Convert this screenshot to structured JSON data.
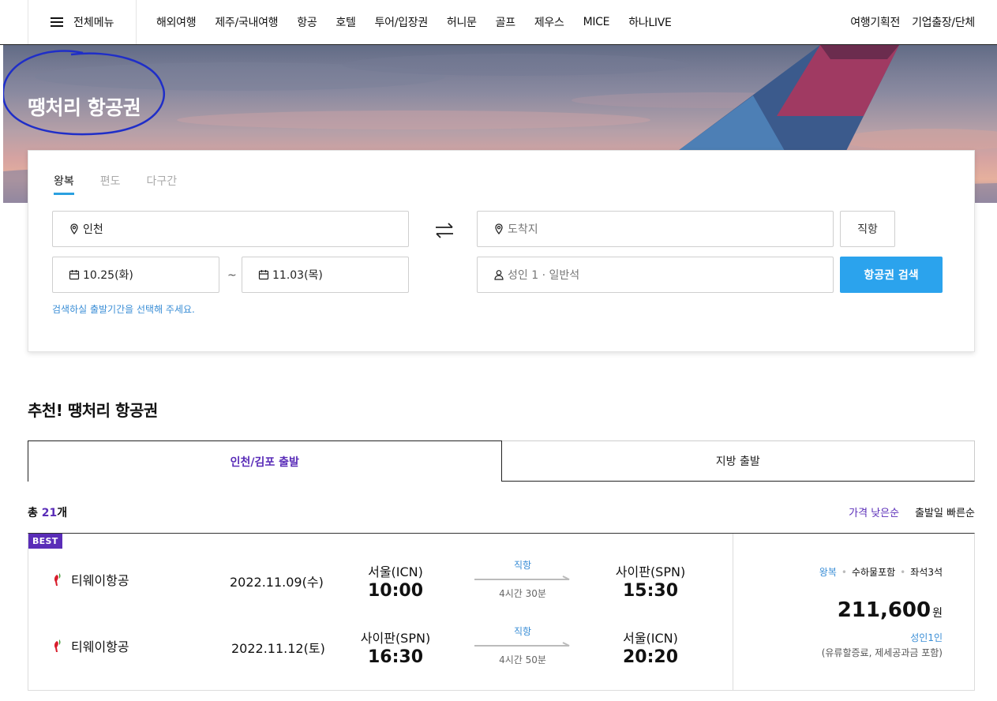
{
  "header": {
    "menu_label": "전체메뉴",
    "nav": [
      "해외여행",
      "제주/국내여행",
      "항공",
      "호텔",
      "투어/입장권",
      "허니문",
      "골프",
      "제우스",
      "MICE",
      "하나LIVE"
    ],
    "right_links": [
      "여행기획전",
      "기업출장/단체"
    ]
  },
  "hero": {
    "title": "땡처리 항공권"
  },
  "search": {
    "tabs": [
      "왕복",
      "편도",
      "다구간"
    ],
    "active_tab": "왕복",
    "origin": "인천",
    "destination_placeholder": "도착지",
    "depart_date": "10.25(화)",
    "return_date": "11.03(목)",
    "date_separator": "~",
    "passengers": "성인 1 · 일반석",
    "direct_label": "직항",
    "search_button": "항공권 검색",
    "hint": "검색하실 출발기간을 선택해 주세요."
  },
  "recommend": {
    "title": "추천! 땡처리 항공권",
    "tabs": [
      "인천/김포 출발",
      "지방 출발"
    ],
    "total_prefix": "총 ",
    "total_count": "21",
    "total_suffix": "개",
    "sorts": [
      "가격 낮은순",
      "출발일 빠른순"
    ],
    "cards": [
      {
        "badge": "BEST",
        "legs": [
          {
            "airline": "티웨이항공",
            "date": "2022.11.09(수)",
            "from": "서울(ICN)",
            "depart": "10:00",
            "kind": "직항",
            "duration": "4시간 30분",
            "to": "사이판(SPN)",
            "arrive": "15:30"
          },
          {
            "airline": "티웨이항공",
            "date": "2022.11.12(토)",
            "from": "사이판(SPN)",
            "depart": "16:30",
            "kind": "직항",
            "duration": "4시간 50분",
            "to": "서울(ICN)",
            "arrive": "20:20"
          }
        ],
        "tags": [
          "왕복",
          "수하물포함",
          "좌석3석"
        ],
        "price": "211,600",
        "unit": "원",
        "per_person": "성인1인",
        "included": "(유류할증료, 제세공과금 포함)"
      }
    ]
  },
  "colors": {
    "accent_blue": "#2ba3ed",
    "accent_purple": "#5a2db8",
    "airline_logo_red": "#d81e2c"
  }
}
